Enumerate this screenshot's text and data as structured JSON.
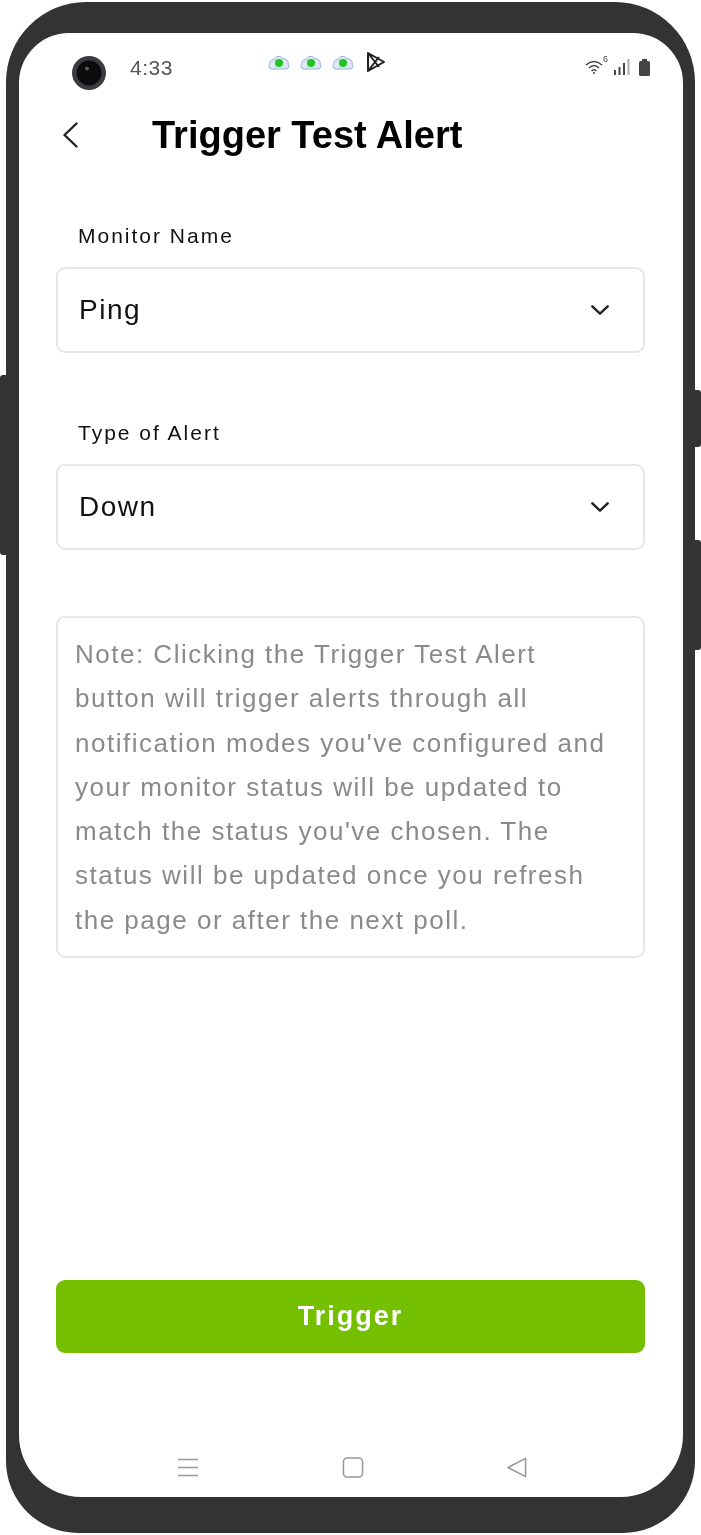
{
  "status_bar": {
    "time": "4:33",
    "wifi_label": "6"
  },
  "header": {
    "title": "Trigger Test Alert"
  },
  "fields": [
    {
      "label": "Monitor Name",
      "value": "Ping"
    },
    {
      "label": "Type of Alert",
      "value": "Down"
    }
  ],
  "note": {
    "lines": [
      "Note: Clicking the Trigger Test Alert",
      "button will trigger alerts through all",
      "notification modes you've configured and",
      "your monitor status will be updated to",
      "match the status you've chosen. The",
      "status will be updated once you refresh",
      "the page or after the next poll."
    ]
  },
  "button": {
    "label": "Trigger"
  }
}
